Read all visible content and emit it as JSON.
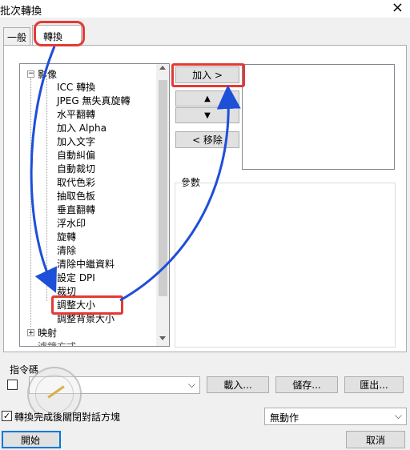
{
  "window": {
    "title": "批次轉換",
    "close_glyph": "×"
  },
  "tabs": [
    {
      "label": "一般"
    },
    {
      "label": "轉換"
    }
  ],
  "tree": {
    "group_image": "影像",
    "group_map": "映射",
    "group_filter": "濾鏡方式",
    "items": [
      "ICC 轉換",
      "JPEG 無失真旋轉",
      "水平翻轉",
      "加入 Alpha",
      "加入文字",
      "自動糾偏",
      "自動裁切",
      "取代色彩",
      "抽取色板",
      "垂直翻轉",
      "浮水印",
      "旋轉",
      "清除",
      "清除中繼資料",
      "設定 DPI",
      "裁切",
      "調整大小",
      "調整背景大小"
    ]
  },
  "buttons": {
    "add": "加入 >",
    "move_up": "▲",
    "move_down": "▼",
    "remove": "< 移除",
    "load": "載入...",
    "save": "儲存...",
    "export": "匯出...",
    "start": "開始",
    "cancel": "取消"
  },
  "params_label": "參數",
  "command_label": "指令碼",
  "close_after_label": "轉換完成後關閉對話方塊",
  "action_select_value": "無動作",
  "colors": {
    "annotation_red": "#e53935",
    "annotation_blue": "#1e4fd8"
  }
}
